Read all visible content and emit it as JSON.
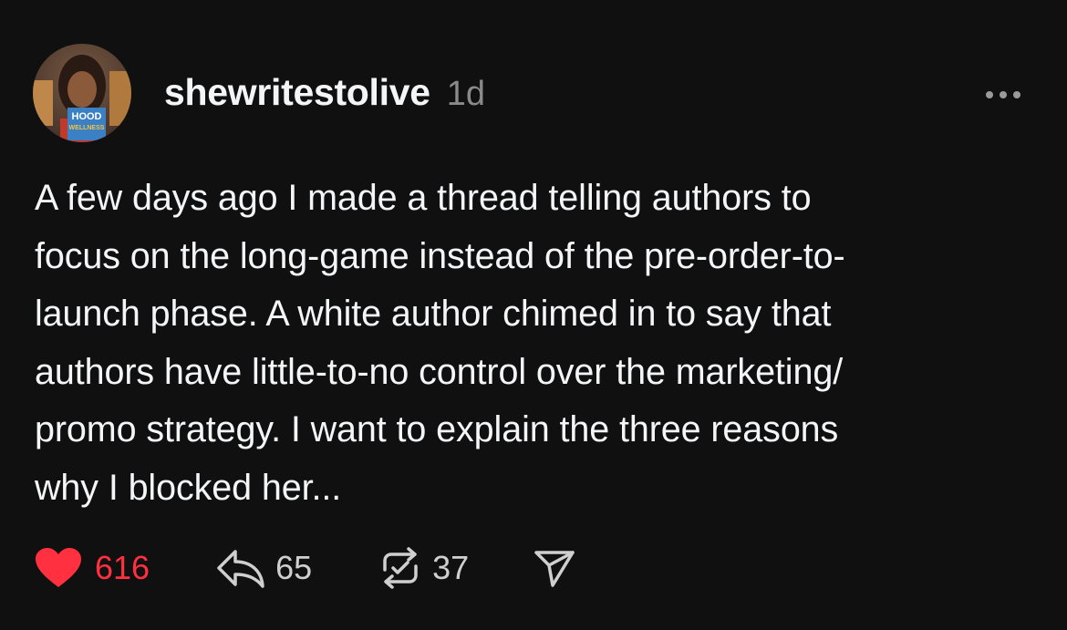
{
  "post": {
    "username": "shewritestolive",
    "timestamp": "1d",
    "avatar_book_title_line1": "HOOD",
    "avatar_book_title_line2": "WELLNESS",
    "text": "A few days ago I made a thread telling authors to\nfocus on the long-game instead of the pre-order-to-\nlaunch phase. A white author chimed in to say that\nauthors have little-to-no control over the marketing/\npromo strategy. I want to  explain the three reasons\nwhy I blocked her..."
  },
  "actions": {
    "like_count": "616",
    "liked": true,
    "reply_count": "65",
    "repost_count": "37"
  },
  "icons": {
    "like": "heart-filled-icon",
    "reply": "reply-arrow-icon",
    "repost": "repost-icon",
    "share": "send-icon",
    "more": "more-horizontal-icon"
  },
  "colors": {
    "background": "#101010",
    "text": "#f3f5f7",
    "muted": "#8a8a8a",
    "like": "#ff3040"
  }
}
